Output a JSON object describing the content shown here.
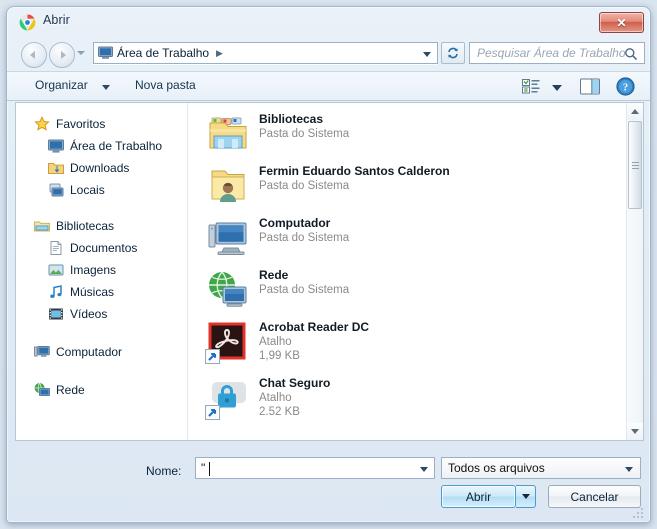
{
  "window": {
    "title": "Abrir",
    "title_icon": "chrome-icon",
    "close_label": "✕"
  },
  "nav": {
    "back_icon": "arrow-left-icon",
    "forward_icon": "arrow-right-icon",
    "history_icon": "chevron-down-icon",
    "address": {
      "icon": "desktop-icon",
      "path": "Área de Trabalho",
      "separator": "▶"
    },
    "refresh_icon": "refresh-icon",
    "search": {
      "placeholder": "Pesquisar Área de Trabalho",
      "icon": "search-icon"
    }
  },
  "toolbar": {
    "organizar_label": "Organizar",
    "nova_pasta_label": "Nova pasta",
    "view_icon": "view-list-icon",
    "view_dropdown_icon": "chevron-down-icon",
    "preview_pane_icon": "preview-pane-icon",
    "help_icon": "help-icon"
  },
  "sidebar": {
    "groups": [
      {
        "label": "Favoritos",
        "icon": "star-icon",
        "items": [
          {
            "label": "Área de Trabalho",
            "icon": "desktop-icon"
          },
          {
            "label": "Downloads",
            "icon": "downloads-folder-icon"
          },
          {
            "label": "Locais",
            "icon": "recent-places-icon"
          }
        ]
      },
      {
        "label": "Bibliotecas",
        "icon": "libraries-icon",
        "items": [
          {
            "label": "Documentos",
            "icon": "documents-icon"
          },
          {
            "label": "Imagens",
            "icon": "pictures-icon"
          },
          {
            "label": "Músicas",
            "icon": "music-icon"
          },
          {
            "label": "Vídeos",
            "icon": "videos-icon"
          }
        ]
      },
      {
        "label": "Computador",
        "icon": "computer-icon",
        "items": []
      },
      {
        "label": "Rede",
        "icon": "network-icon",
        "items": []
      }
    ]
  },
  "files": [
    {
      "name": "Bibliotecas",
      "type": "Pasta do Sistema",
      "size": "",
      "icon": "libraries-folder-icon"
    },
    {
      "name": "Fermin Eduardo Santos Calderon",
      "type": "Pasta do Sistema",
      "size": "",
      "icon": "user-folder-icon"
    },
    {
      "name": "Computador",
      "type": "Pasta do Sistema",
      "size": "",
      "icon": "computer-icon"
    },
    {
      "name": "Rede",
      "type": "Pasta do Sistema",
      "size": "",
      "icon": "network-icon"
    },
    {
      "name": "Acrobat Reader DC",
      "type": "Atalho",
      "size": "1,99 KB",
      "icon": "acrobat-icon"
    },
    {
      "name": "Chat Seguro",
      "type": "Atalho",
      "size": "2.52 KB",
      "icon": "chat-lock-icon"
    }
  ],
  "footer": {
    "name_label": "Nome:",
    "name_value": "\"",
    "filter_value": "Todos os arquivos",
    "open_label": "Abrir",
    "open_dropdown_icon": "chevron-down-icon",
    "cancel_label": "Cancelar",
    "resize_grip_icon": "resize-grip-icon"
  },
  "colors": {
    "accent": "#4a9cc9",
    "title_text": "#1b3650",
    "close_red": "#cd5f4d",
    "subtext": "#8a8a8a"
  }
}
